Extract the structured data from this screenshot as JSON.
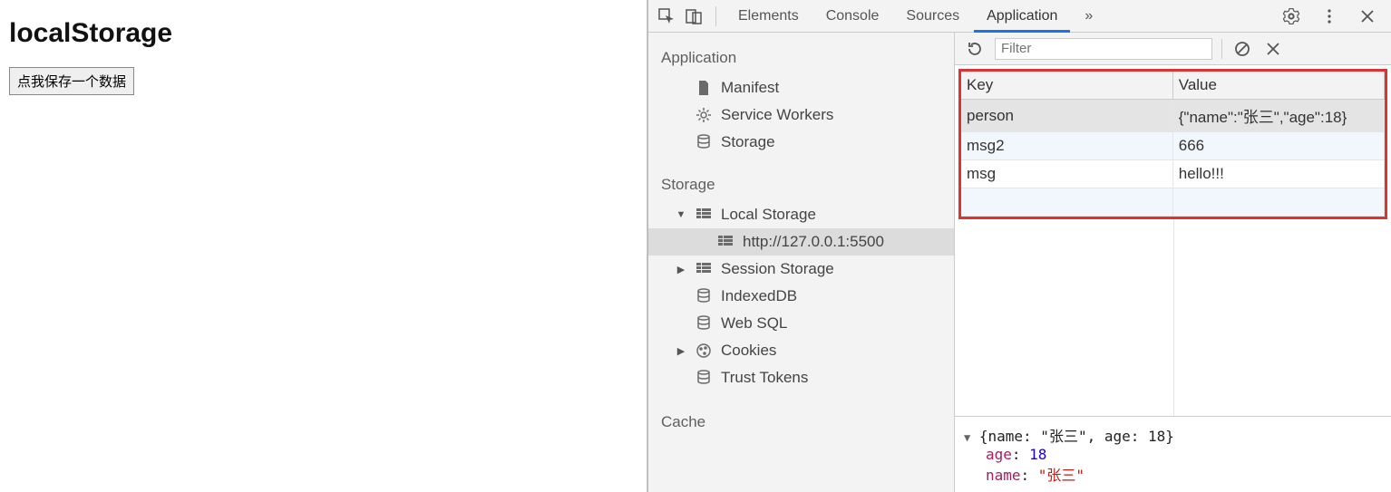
{
  "page": {
    "title": "localStorage",
    "button_label": "点我保存一个数据"
  },
  "devtools": {
    "tabs": [
      "Elements",
      "Console",
      "Sources",
      "Application"
    ],
    "active_tab": "Application",
    "more": "»"
  },
  "toolbar": {
    "filter_placeholder": "Filter"
  },
  "sidebar": {
    "sections": {
      "application": {
        "title": "Application",
        "items": [
          "Manifest",
          "Service Workers",
          "Storage"
        ]
      },
      "storage": {
        "title": "Storage",
        "local_storage": "Local Storage",
        "origin": "http://127.0.0.1:5500",
        "session_storage": "Session Storage",
        "indexeddb": "IndexedDB",
        "websql": "Web SQL",
        "cookies": "Cookies",
        "trust_tokens": "Trust Tokens"
      },
      "cache": {
        "title": "Cache"
      }
    }
  },
  "table": {
    "headers": {
      "key": "Key",
      "value": "Value"
    },
    "rows": [
      {
        "key": "person",
        "value": "{\"name\":\"张三\",\"age\":18}",
        "selected": true
      },
      {
        "key": "msg2",
        "value": "666",
        "alt": true
      },
      {
        "key": "msg",
        "value": "hello!!!"
      }
    ]
  },
  "viewer": {
    "summary_open": "{name: \"张三\", age: 18}",
    "lines": [
      {
        "k": "age",
        "v": "18",
        "type": "num"
      },
      {
        "k": "name",
        "v": "\"张三\"",
        "type": "str"
      }
    ]
  }
}
